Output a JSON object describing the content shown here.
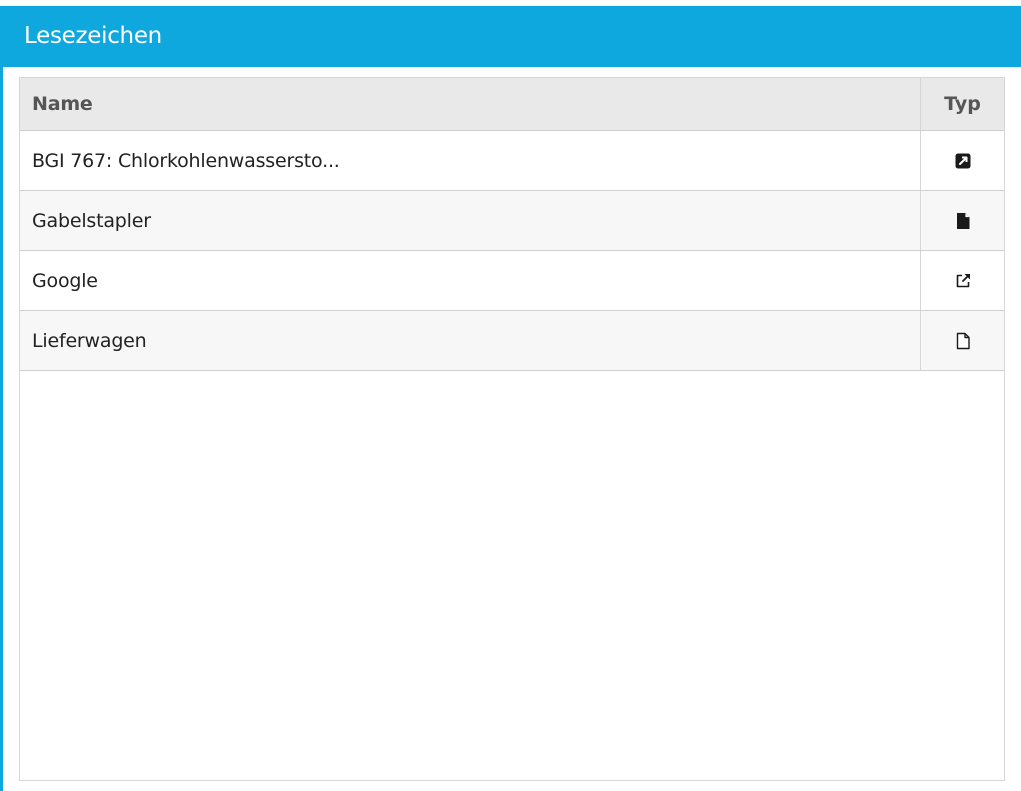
{
  "panel": {
    "title": "Lesezeichen"
  },
  "table": {
    "columns": {
      "name": "Name",
      "type": "Typ"
    },
    "rows": [
      {
        "name": "BGI 767: Chlorkohlenwassersto...",
        "type_icon": "shortcut-link-icon"
      },
      {
        "name": "Gabelstapler",
        "type_icon": "document-filled-icon"
      },
      {
        "name": "Google",
        "type_icon": "external-link-icon"
      },
      {
        "name": "Lieferwagen",
        "type_icon": "document-outline-icon"
      }
    ]
  },
  "colors": {
    "accent": "#0ea8de",
    "header_bg": "#e9e9e9",
    "row_alt_bg": "#f7f7f7",
    "border": "#cfcfcf"
  }
}
